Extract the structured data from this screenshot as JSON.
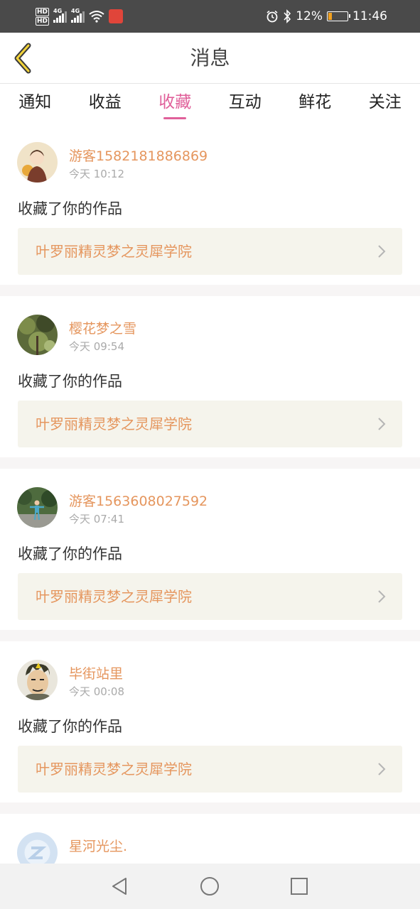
{
  "status_bar": {
    "network_left": "HD",
    "signal_1": "4G",
    "signal_2": "4G",
    "battery_percent": "12%",
    "time": "11:46",
    "icons": [
      "alarm-icon",
      "bluetooth-icon",
      "battery-icon",
      "wifi-icon"
    ]
  },
  "header": {
    "title": "消息"
  },
  "tabs": [
    {
      "label": "通知",
      "active": false
    },
    {
      "label": "收益",
      "active": false
    },
    {
      "label": "收藏",
      "active": true
    },
    {
      "label": "互动",
      "active": false
    },
    {
      "label": "鲜花",
      "active": false
    },
    {
      "label": "关注",
      "active": false
    }
  ],
  "colors": {
    "accent": "#e0609a",
    "username": "#e5965e",
    "work_bg": "#f5f4ec"
  },
  "messages": [
    {
      "username": "游客1582181886869",
      "time": "今天 10:12",
      "action": "收藏了你的作品",
      "work_title": "叶罗丽精灵梦之灵犀学院"
    },
    {
      "username": "樱花梦之雪",
      "time": "今天 09:54",
      "action": "收藏了你的作品",
      "work_title": "叶罗丽精灵梦之灵犀学院"
    },
    {
      "username": "游客1563608027592",
      "time": "今天 07:41",
      "action": "收藏了你的作品",
      "work_title": "叶罗丽精灵梦之灵犀学院"
    },
    {
      "username": "毕街站里",
      "time": "今天 00:08",
      "action": "收藏了你的作品",
      "work_title": "叶罗丽精灵梦之灵犀学院"
    },
    {
      "username": "星河光尘.",
      "time": ""
    }
  ]
}
